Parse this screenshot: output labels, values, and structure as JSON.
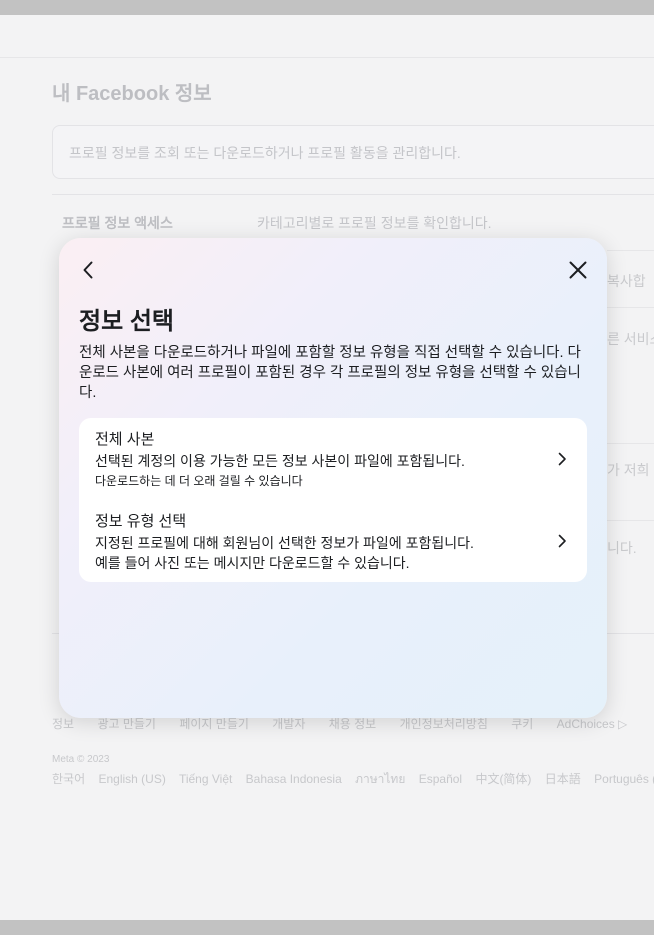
{
  "background": {
    "title": "내 Facebook 정보",
    "description": "프로필 정보를 조회 또는 다운로드하거나 프로필 활동을 관리합니다.",
    "row_label": "프로필 정보 액세스",
    "row_value": "카테고리별로 프로필 정보를 확인합니다.",
    "peek_texts": [
      "복사합",
      "른 서비스",
      "가 저희",
      "니다."
    ]
  },
  "footer": {
    "links": [
      "정보",
      "광고 만들기",
      "페이지 만들기",
      "개발자",
      "채용 정보",
      "개인정보처리방침",
      "쿠키",
      "AdChoices ▷"
    ],
    "copyright": "Meta © 2023",
    "languages": [
      "한국어",
      "English (US)",
      "Tiếng Việt",
      "Bahasa Indonesia",
      "ภาษาไทย",
      "Español",
      "中文(简体)",
      "日本語",
      "Português (Brasil)"
    ]
  },
  "modal": {
    "title": "정보 선택",
    "description": "전체 사본을 다운로드하거나 파일에 포함할 정보 유형을 직접 선택할 수 있습니다. 다운로드 사본에 여러 프로필이 포함된 경우 각 프로필의 정보 유형을 선택할 수 있습니다.",
    "icons": {
      "back": "chevron-left-icon",
      "close": "close-icon",
      "option": "chevron-right-icon"
    },
    "options": [
      {
        "title": "전체 사본",
        "description": "선택된 계정의 이용 가능한 모든 정보 사본이 파일에 포함됩니다.",
        "note": "다운로드하는 데 더 오래 걸릴 수 있습니다"
      },
      {
        "title": "정보 유형 선택",
        "description": "지정된 프로필에 대해 회원님이 선택한 정보가 파일에 포함됩니다.",
        "note": "예를 들어 사진 또는 메시지만 다운로드할 수 있습니다."
      }
    ]
  }
}
